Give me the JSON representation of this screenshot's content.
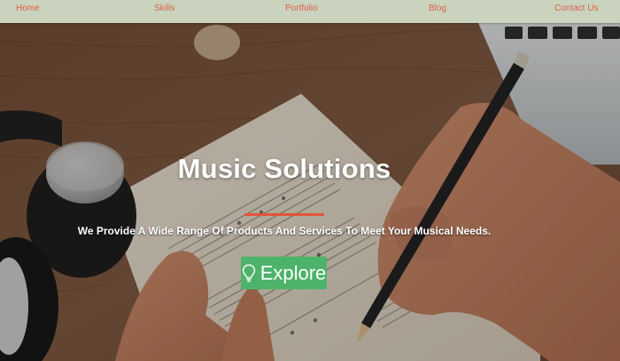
{
  "nav": {
    "items": [
      {
        "label": "Home"
      },
      {
        "label": "Skills"
      },
      {
        "label": "Portfolio"
      },
      {
        "label": "Blog"
      },
      {
        "label": "Contact Us"
      }
    ]
  },
  "hero": {
    "title": "Music Solutions",
    "subtitle": "We Provide A Wide Range Of Products And Services To Meet Your Musical Needs.",
    "button": {
      "label": "Explore",
      "icon": "lightbulb-icon"
    }
  },
  "colors": {
    "nav_background": "#c9d3bd",
    "nav_link": "#e0604a",
    "title_underline": "#e5533b",
    "button_background": "#4db36a"
  }
}
